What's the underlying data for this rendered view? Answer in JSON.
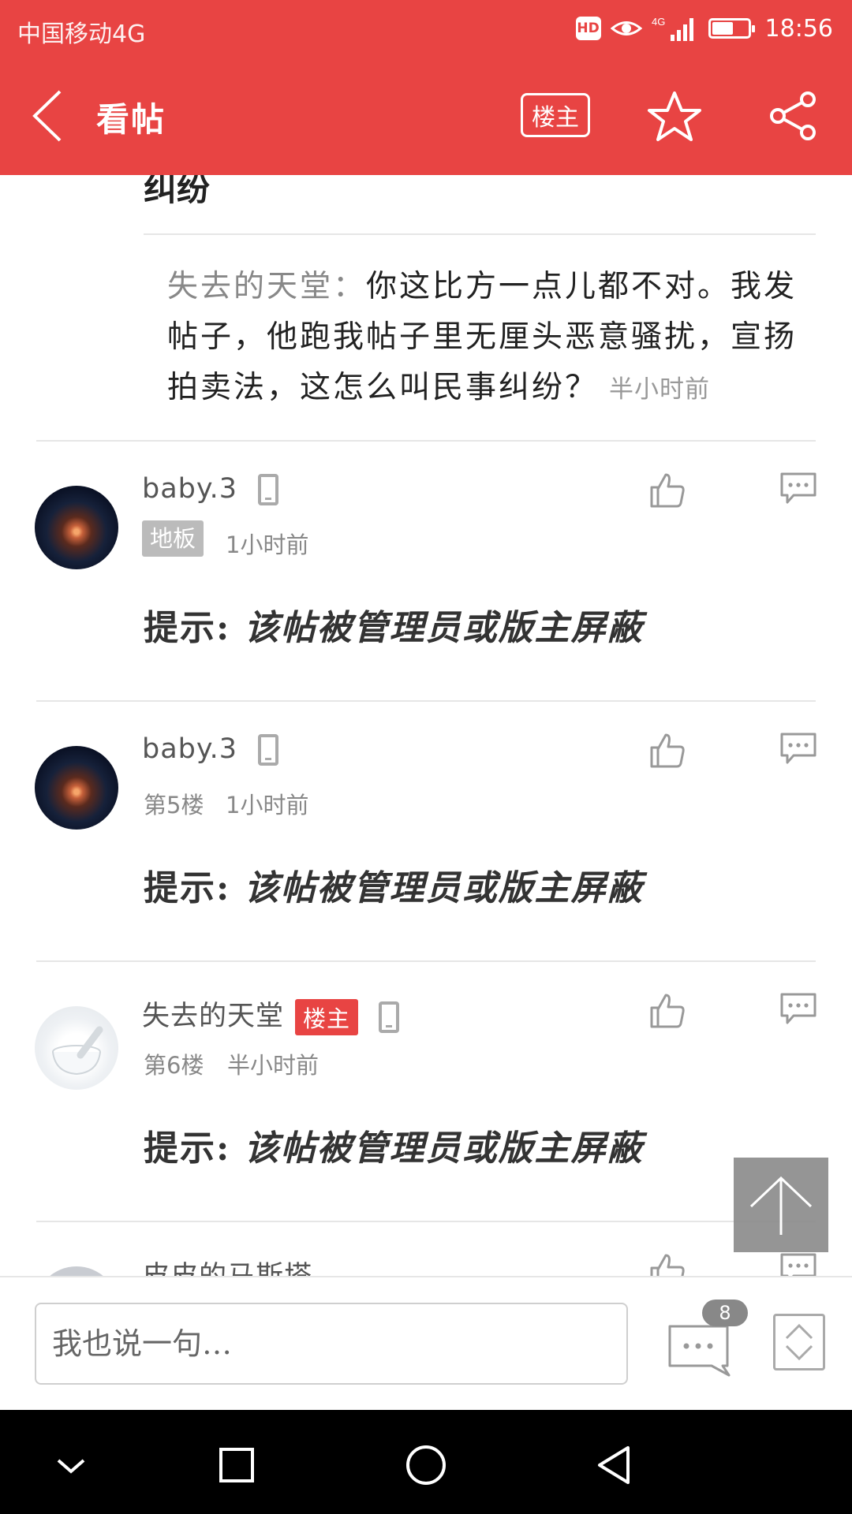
{
  "status_bar": {
    "carrier": "中国移动4G",
    "hd_label": "HD",
    "network_label": "4G",
    "time": "18:56",
    "battery_level": 0.6
  },
  "app_bar": {
    "title": "看帖",
    "op_filter_label": "楼主",
    "icons": [
      "back-icon",
      "star-icon",
      "share-icon"
    ]
  },
  "quoted_reply": {
    "cut_title": "纠纷",
    "author": "失去的天堂：",
    "text": "你这比方一点儿都不对。我发帖子，他跑我帖子里无厘头恶意骚扰，宣扬拍卖法，这怎么叫民事纠纷？",
    "time": "半小时前"
  },
  "posts": [
    {
      "username": "baby.3",
      "floor": "地板",
      "floor_style": "badge",
      "time": "1小时前",
      "is_op": false,
      "notice_prefix": "提示:",
      "notice_body": "该帖被管理员或版主屏蔽"
    },
    {
      "username": "baby.3",
      "floor": "第5楼",
      "floor_style": "text",
      "time": "1小时前",
      "is_op": false,
      "notice_prefix": "提示:",
      "notice_body": "该帖被管理员或版主屏蔽"
    },
    {
      "username": "失去的天堂",
      "op_tag": "楼主",
      "floor": "第6楼",
      "floor_style": "text",
      "time": "半小时前",
      "is_op": true,
      "notice_prefix": "提示:",
      "notice_body": "该帖被管理员或版主屏蔽"
    },
    {
      "username": "皮皮的马斯塔"
    }
  ],
  "bottom_bar": {
    "input_placeholder": "我也说一句…",
    "comment_count": "8"
  },
  "colors": {
    "accent": "#e84443",
    "badge_gray": "#bbbbbb",
    "divider": "#e6e6e6"
  }
}
